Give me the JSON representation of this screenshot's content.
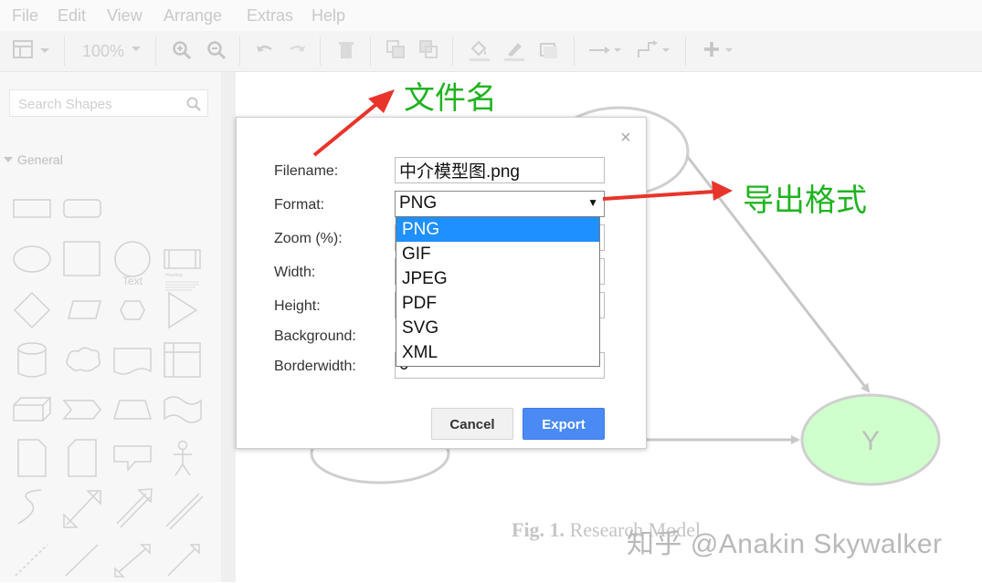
{
  "menu": [
    "File",
    "Edit",
    "View",
    "Arrange",
    "Extras",
    "Help"
  ],
  "toolbar": {
    "zoom": "100%"
  },
  "sidebar": {
    "search_placeholder": "Search Shapes",
    "section": "General",
    "shape_text": "Text",
    "shape_heading": "Heading"
  },
  "canvas": {
    "node_y_label": "Y",
    "caption_prefix": "Fig. 1.",
    "caption_text": "Research Model",
    "watermark": "知乎 @Anakin Skywalker"
  },
  "dialog": {
    "labels": {
      "filename": "Filename:",
      "format": "Format:",
      "zoom": "Zoom (%):",
      "width": "Width:",
      "height": "Height:",
      "background": "Background:",
      "borderwidth": "Borderwidth:"
    },
    "filename_value": "中介模型图.png",
    "format_value": "PNG",
    "borderwidth_value": "0",
    "format_options": [
      "PNG",
      "GIF",
      "JPEG",
      "PDF",
      "SVG",
      "XML"
    ],
    "cancel": "Cancel",
    "export": "Export",
    "close_glyph": "×"
  },
  "annotations": {
    "filename_note": "文件名",
    "format_note": "导出格式"
  },
  "colors": {
    "annotation_text": "#1fb31f",
    "annotation_arrow": "#e8342a",
    "export_button": "#4a8af4",
    "selected_option": "#1e90ff",
    "node_y_fill": "#cfffcc"
  }
}
